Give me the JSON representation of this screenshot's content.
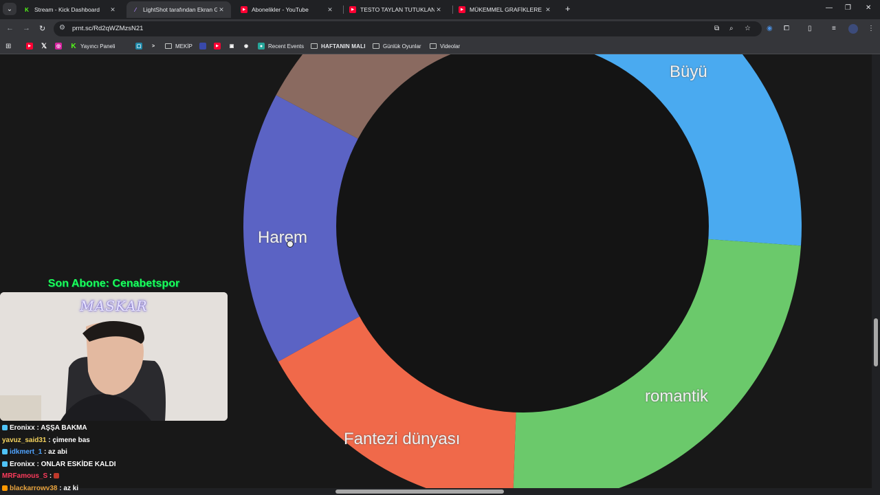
{
  "browser": {
    "tabs": [
      {
        "title": "Stream - Kick Dashboard",
        "icon": "kick-icon",
        "color": "#53fc18",
        "active": false
      },
      {
        "title": "LightShot tarafından Ekran Görü",
        "icon": "lightshot-icon",
        "color": "#b388ff",
        "active": true
      },
      {
        "title": "Abonelikler - YouTube",
        "icon": "youtube-icon",
        "color": "#ff0033",
        "active": false
      },
      {
        "title": "TESTO TAYLAN TUTUKLANDI. -",
        "icon": "youtube-icon",
        "color": "#ff0033",
        "active": false
      },
      {
        "title": "MÜKEMMEL GRAFİKLERE SAHİ",
        "icon": "youtube-icon",
        "color": "#ff0033",
        "active": false
      }
    ],
    "url": "prnt.sc/Rd2qWZMzsN21",
    "bookmarks": [
      {
        "label": "",
        "icon": "youtube-icon"
      },
      {
        "label": "",
        "icon": "x-icon"
      },
      {
        "label": "",
        "icon": "instagram-icon"
      },
      {
        "label": "Yayıncı Paneli",
        "icon": "kick-icon"
      },
      {
        "label": "",
        "icon": "app-icon"
      },
      {
        "label": "",
        "icon": "arrow-icon"
      },
      {
        "label": "MEKİP",
        "icon": "folder-icon"
      },
      {
        "label": "",
        "icon": "box-icon"
      },
      {
        "label": "",
        "icon": "youtube-icon"
      },
      {
        "label": "",
        "icon": "image-icon"
      },
      {
        "label": "",
        "icon": "circle-icon"
      },
      {
        "label": "Recent Events",
        "icon": "events-icon"
      },
      {
        "label": "HAFTANIN MALI",
        "icon": "folder-icon"
      },
      {
        "label": "Günlük Oyunlar",
        "icon": "folder-icon"
      },
      {
        "label": "Videolar",
        "icon": "folder-icon"
      }
    ]
  },
  "chart_data": {
    "type": "pie",
    "labels": [
      "Büyü",
      "romantik",
      "Fantezi dünyası",
      "Harem",
      ""
    ],
    "colors": [
      "#4aaaf0",
      "#6bc96b",
      "#f0694a",
      "#5b63c4",
      "#8a6a60"
    ]
  },
  "overlay": {
    "last_sub": "Son Abone: Cenabetspor",
    "webcam_logo": "MASKAR"
  },
  "chat": [
    {
      "user": "Eronixx",
      "text": "AŞŞA BAKMA",
      "color": "#ffffff",
      "badge": "#4fc3f7"
    },
    {
      "user": "yavuz_said31",
      "text": "çimene bas",
      "color": "#f4d35e",
      "badge": ""
    },
    {
      "user": "idkmert_1",
      "text": "az abi",
      "color": "#4fa3ff",
      "badge": "#4fc3f7"
    },
    {
      "user": "Eronixx",
      "text": "ONLAR ESKİDE KALDI",
      "color": "#ffffff",
      "badge": "#4fc3f7"
    },
    {
      "user": "MRFamous_S",
      "text": "",
      "color": "#ff3b5c",
      "badge": ""
    },
    {
      "user": "blackarrowv38",
      "text": "az ki",
      "color": "#e8a33d",
      "badge": "#ff9800"
    }
  ]
}
